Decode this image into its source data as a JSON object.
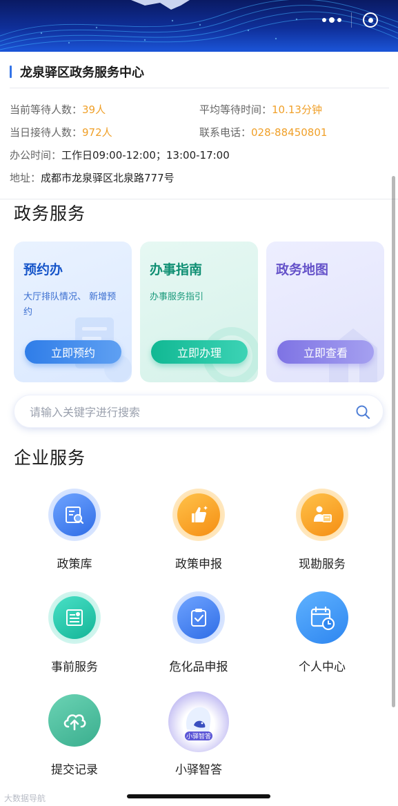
{
  "capsule": {
    "more_icon": "more-dots-icon",
    "close_icon": "close-miniprogram-icon"
  },
  "info": {
    "title": "龙泉驿区政务服务中心",
    "waiting_label": "当前等待人数：",
    "waiting_value": "39人",
    "avg_wait_label": "平均等待时间：",
    "avg_wait_value": "10.13分钟",
    "received_label": "当日接待人数：",
    "received_value": "972人",
    "phone_label": "联系电话：",
    "phone_value": "028-88450801",
    "hours_label": "办公时间：",
    "hours_value": "工作日09:00-12:00；13:00-17:00",
    "address_label": "地址：",
    "address_value": "成都市龙泉驿区北泉路777号"
  },
  "gov_services": {
    "title": "政务服务",
    "cards": [
      {
        "title": "预约办",
        "desc": "大厅排队情况、 新增预约",
        "button": "立即预约",
        "icon": "queue-ticket-icon"
      },
      {
        "title": "办事指南",
        "desc": "办事服务指引",
        "button": "立即办理",
        "icon": "guide-compass-icon"
      },
      {
        "title": "政务地图",
        "desc": "",
        "button": "立即查看",
        "icon": "building-map-icon"
      }
    ]
  },
  "search": {
    "placeholder": "请输入关键字进行搜索",
    "icon": "search-icon"
  },
  "enterprise": {
    "title": "企业服务",
    "items": [
      {
        "label": "政策库",
        "icon": "policy-library-icon"
      },
      {
        "label": "政策申报",
        "icon": "thumbs-up-icon"
      },
      {
        "label": "现勘服务",
        "icon": "site-survey-icon"
      },
      {
        "label": "事前服务",
        "icon": "document-icon"
      },
      {
        "label": "危化品申报",
        "icon": "clipboard-check-icon"
      },
      {
        "label": "个人中心",
        "icon": "calendar-clock-icon"
      },
      {
        "label": "提交记录",
        "icon": "cloud-upload-icon"
      },
      {
        "label": "小驿智答",
        "icon": "ai-assistant-icon",
        "badge": "小驿智答"
      }
    ]
  },
  "watermark": "大数据导航"
}
